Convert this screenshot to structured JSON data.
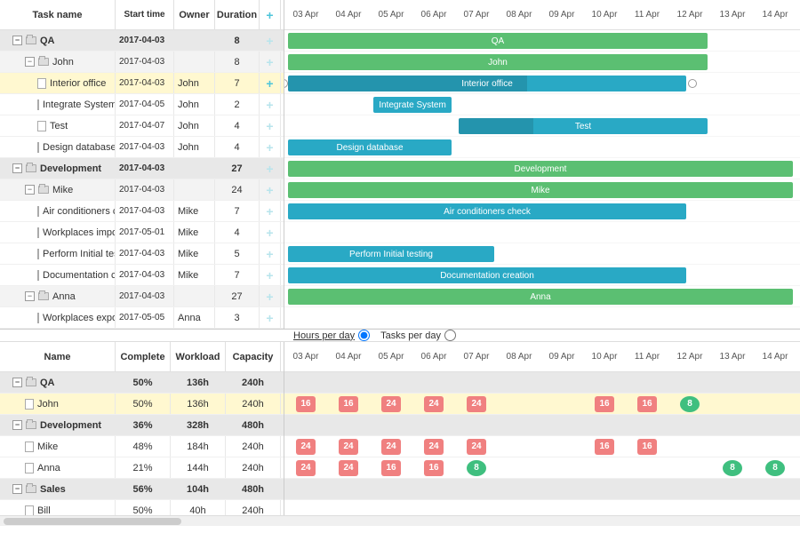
{
  "chart_data": {
    "type": "gantt",
    "date_columns": [
      "03 Apr",
      "04 Apr",
      "05 Apr",
      "06 Apr",
      "07 Apr",
      "08 Apr",
      "09 Apr",
      "10 Apr",
      "11 Apr",
      "12 Apr",
      "13 Apr",
      "14 Apr"
    ],
    "tasks": [
      {
        "id": "qa",
        "name": "QA",
        "start": "2017-04-03",
        "duration": 8,
        "type": "group",
        "level": 0,
        "color": "green",
        "bar_start": 0,
        "bar_len": 10
      },
      {
        "id": "john",
        "name": "John",
        "start": "2017-04-03",
        "duration": 8,
        "type": "group",
        "level": 1,
        "color": "green",
        "bar_start": 0,
        "bar_len": 10
      },
      {
        "id": "interior",
        "name": "Interior office",
        "start": "2017-04-03",
        "owner": "John",
        "duration": 7,
        "type": "task",
        "level": 2,
        "color": "blue",
        "bar_start": 0,
        "bar_len": 9.5,
        "progress": 0.6,
        "selected": true
      },
      {
        "id": "integrate",
        "name": "Integrate System",
        "start": "2017-04-05",
        "owner": "John",
        "duration": 2,
        "type": "task",
        "level": 2,
        "color": "blue",
        "bar_start": 2,
        "bar_len": 2
      },
      {
        "id": "test",
        "name": "Test",
        "start": "2017-04-07",
        "owner": "John",
        "duration": 4,
        "type": "task",
        "level": 2,
        "color": "blue",
        "bar_start": 4,
        "bar_len": 6,
        "progress": 0.3
      },
      {
        "id": "design",
        "name": "Design database",
        "start": "2017-04-03",
        "owner": "John",
        "duration": 4,
        "type": "task",
        "level": 2,
        "color": "blue",
        "bar_start": 0,
        "bar_len": 4
      },
      {
        "id": "dev",
        "name": "Development",
        "start": "2017-04-03",
        "duration": 27,
        "type": "group",
        "level": 0,
        "color": "green",
        "bar_start": 0,
        "bar_len": 12
      },
      {
        "id": "mike",
        "name": "Mike",
        "start": "2017-04-03",
        "duration": 24,
        "type": "group",
        "level": 1,
        "color": "green",
        "bar_start": 0,
        "bar_len": 12
      },
      {
        "id": "ac",
        "name": "Air conditioners check",
        "start": "2017-04-03",
        "owner": "Mike",
        "duration": 7,
        "type": "task",
        "level": 2,
        "color": "blue",
        "bar_start": 0,
        "bar_len": 9.5
      },
      {
        "id": "wi",
        "name": "Workplaces importation",
        "start": "2017-05-01",
        "owner": "Mike",
        "duration": 4,
        "type": "task",
        "level": 2,
        "color": "blue"
      },
      {
        "id": "pit",
        "name": "Perform Initial testing",
        "start": "2017-04-03",
        "owner": "Mike",
        "duration": 5,
        "type": "task",
        "level": 2,
        "color": "blue",
        "bar_start": 0,
        "bar_len": 5
      },
      {
        "id": "doc",
        "name": "Documentation creation",
        "start": "2017-04-03",
        "owner": "Mike",
        "duration": 7,
        "type": "task",
        "level": 2,
        "color": "blue",
        "bar_start": 0,
        "bar_len": 9.5
      },
      {
        "id": "anna",
        "name": "Anna",
        "start": "2017-04-03",
        "duration": 27,
        "type": "group",
        "level": 1,
        "color": "green",
        "bar_start": 0,
        "bar_len": 12
      },
      {
        "id": "we",
        "name": "Workplaces exportation",
        "start": "2017-05-05",
        "owner": "Anna",
        "duration": 3,
        "type": "task",
        "level": 2,
        "color": "blue"
      }
    ]
  },
  "grid_headers": {
    "name": "Task name",
    "start": "Start time",
    "owner": "Owner",
    "dur": "Duration"
  },
  "mode": {
    "hours": "Hours per day",
    "tasks": "Tasks per day",
    "selected": "hours"
  },
  "resource_headers": {
    "name": "Name",
    "complete": "Complete",
    "workload": "Workload",
    "capacity": "Capacity"
  },
  "resources": [
    {
      "name": "QA",
      "complete": "50%",
      "workload": "136h",
      "capacity": "240h",
      "type": "group",
      "level": 0
    },
    {
      "name": "John",
      "complete": "50%",
      "workload": "136h",
      "capacity": "240h",
      "type": "person",
      "level": 1,
      "selected": true,
      "cells": [
        {
          "d": 0,
          "v": 16,
          "s": "over"
        },
        {
          "d": 1,
          "v": 16,
          "s": "over"
        },
        {
          "d": 2,
          "v": 24,
          "s": "over"
        },
        {
          "d": 3,
          "v": 24,
          "s": "over"
        },
        {
          "d": 4,
          "v": 24,
          "s": "over"
        },
        {
          "d": 7,
          "v": 16,
          "s": "over"
        },
        {
          "d": 8,
          "v": 16,
          "s": "over"
        },
        {
          "d": 9,
          "v": 8,
          "s": "ok"
        }
      ]
    },
    {
      "name": "Development",
      "complete": "36%",
      "workload": "328h",
      "capacity": "480h",
      "type": "group",
      "level": 0
    },
    {
      "name": "Mike",
      "complete": "48%",
      "workload": "184h",
      "capacity": "240h",
      "type": "person",
      "level": 1,
      "cells": [
        {
          "d": 0,
          "v": 24,
          "s": "over"
        },
        {
          "d": 1,
          "v": 24,
          "s": "over"
        },
        {
          "d": 2,
          "v": 24,
          "s": "over"
        },
        {
          "d": 3,
          "v": 24,
          "s": "over"
        },
        {
          "d": 4,
          "v": 24,
          "s": "over"
        },
        {
          "d": 7,
          "v": 16,
          "s": "over"
        },
        {
          "d": 8,
          "v": 16,
          "s": "over"
        }
      ]
    },
    {
      "name": "Anna",
      "complete": "21%",
      "workload": "144h",
      "capacity": "240h",
      "type": "person",
      "level": 1,
      "cells": [
        {
          "d": 0,
          "v": 24,
          "s": "over"
        },
        {
          "d": 1,
          "v": 24,
          "s": "over"
        },
        {
          "d": 2,
          "v": 16,
          "s": "over"
        },
        {
          "d": 3,
          "v": 16,
          "s": "over"
        },
        {
          "d": 4,
          "v": 8,
          "s": "ok"
        },
        {
          "d": 10,
          "v": 8,
          "s": "ok"
        },
        {
          "d": 11,
          "v": 8,
          "s": "ok"
        }
      ]
    },
    {
      "name": "Sales",
      "complete": "56%",
      "workload": "104h",
      "capacity": "480h",
      "type": "group",
      "level": 0
    },
    {
      "name": "Bill",
      "complete": "50%",
      "workload": "40h",
      "capacity": "240h",
      "type": "person",
      "level": 1
    }
  ]
}
